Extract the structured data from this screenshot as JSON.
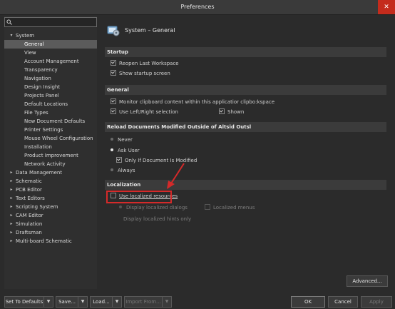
{
  "window": {
    "title": "Preferences",
    "close_label": "✕"
  },
  "search": {
    "placeholder": ""
  },
  "tree": [
    {
      "label": "System",
      "level": 0,
      "expanded": true
    },
    {
      "label": "General",
      "level": 1,
      "selected": true
    },
    {
      "label": "View",
      "level": 1
    },
    {
      "label": "Account Management",
      "level": 1
    },
    {
      "label": "Transparency",
      "level": 1
    },
    {
      "label": "Navigation",
      "level": 1
    },
    {
      "label": "Design Insight",
      "level": 1
    },
    {
      "label": "Projects Panel",
      "level": 1
    },
    {
      "label": "Default Locations",
      "level": 1
    },
    {
      "label": "File Types",
      "level": 1
    },
    {
      "label": "New Document Defaults",
      "level": 1
    },
    {
      "label": "Printer Settings",
      "level": 1
    },
    {
      "label": "Mouse Wheel Configuration",
      "level": 1
    },
    {
      "label": "Installation",
      "level": 1
    },
    {
      "label": "Product Improvement",
      "level": 1
    },
    {
      "label": "Network Activity",
      "level": 1
    },
    {
      "label": "Data Management",
      "level": 0
    },
    {
      "label": "Schematic",
      "level": 0
    },
    {
      "label": "PCB Editor",
      "level": 0
    },
    {
      "label": "Text Editors",
      "level": 0
    },
    {
      "label": "Scripting System",
      "level": 0
    },
    {
      "label": "CAM Editor",
      "level": 0
    },
    {
      "label": "Simulation",
      "level": 0
    },
    {
      "label": "Draftsman",
      "level": 0
    },
    {
      "label": "Multi-board Schematic",
      "level": 0
    }
  ],
  "page": {
    "title": "System – General",
    "icon": "system-general-icon"
  },
  "sections": {
    "startup": {
      "header": "Startup",
      "reopen": "Reopen Last Workspace",
      "show_startup": "Show startup screen"
    },
    "general": {
      "header": "General",
      "clipboard": "Monitor clipboard content within this applicatior clipbo:kspace",
      "left_right": "Use Left/Right selection",
      "shown": "Shown"
    },
    "reload": {
      "header": "Reload Documents Modified Outside of Altsid Outsl",
      "never": "Never",
      "ask_user": "Ask User",
      "only_if_modified": "Only If Document Is Modified",
      "always": "Always"
    },
    "localization": {
      "header": "Localization",
      "use_localized": "Use localized resources",
      "display_dialogs": "Display localized dialogs",
      "localized_menus": "Localized menus",
      "display_hints": "Display localized hints only"
    }
  },
  "buttons": {
    "advanced": "Advanced...",
    "set_to_defaults": "Set To Defaults",
    "save": "Save...",
    "load": "Load...",
    "import_from": "Import From...",
    "ok": "OK",
    "cancel": "Cancel",
    "apply": "Apply"
  },
  "colors": {
    "highlight": "#d52a2a",
    "selected_bg": "#5b5b5b",
    "close_bg": "#c42b1c"
  }
}
